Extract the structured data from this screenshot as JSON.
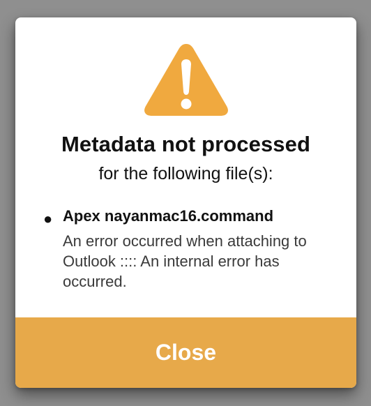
{
  "dialog": {
    "icon": "warning-triangle-icon",
    "title": "Metadata not processed",
    "subtitle": "for the following file(s):",
    "files": [
      {
        "name": "Apex nayanmac16.command",
        "error": "An error occurred when attaching to Outlook :::: An internal error has occurred."
      }
    ],
    "close_label": "Close"
  },
  "colors": {
    "accent": "#e7a94a",
    "icon": "#f0a93f",
    "backdrop": "#8f8f8f",
    "dialog_bg": "#ffffff"
  }
}
